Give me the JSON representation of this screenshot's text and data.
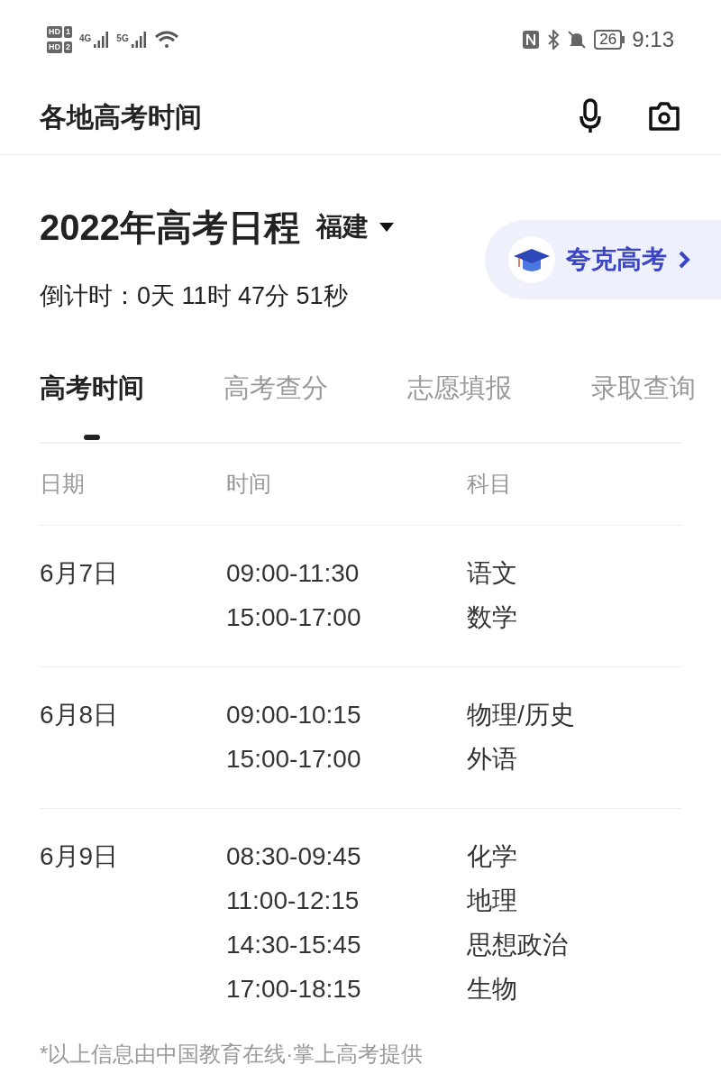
{
  "status_bar": {
    "sims": [
      {
        "label": "HD",
        "slot": "1"
      },
      {
        "label": "HD",
        "slot": "2"
      }
    ],
    "networks": [
      "4G",
      "5G"
    ],
    "battery": "26",
    "time": "9:13"
  },
  "header": {
    "title": "各地高考时间"
  },
  "schedule": {
    "title": "2022年高考日程",
    "region": "福建",
    "countdown_label": "倒计时：",
    "countdown": "0天 11时 47分 51秒",
    "promo": "夸克高考"
  },
  "tabs": [
    {
      "label": "高考时间",
      "selected": true
    },
    {
      "label": "高考查分",
      "selected": false
    },
    {
      "label": "志愿填报",
      "selected": false
    },
    {
      "label": "录取查询",
      "selected": false
    }
  ],
  "table": {
    "columns": [
      "日期",
      "时间",
      "科目"
    ],
    "rows": [
      {
        "date": "6月7日",
        "sessions": [
          {
            "time": "09:00-11:30",
            "subject": "语文"
          },
          {
            "time": "15:00-17:00",
            "subject": "数学"
          }
        ]
      },
      {
        "date": "6月8日",
        "sessions": [
          {
            "time": "09:00-10:15",
            "subject": "物理/历史"
          },
          {
            "time": "15:00-17:00",
            "subject": "外语"
          }
        ]
      },
      {
        "date": "6月9日",
        "sessions": [
          {
            "time": "08:30-09:45",
            "subject": "化学"
          },
          {
            "time": "11:00-12:15",
            "subject": "地理"
          },
          {
            "time": "14:30-15:45",
            "subject": "思想政治"
          },
          {
            "time": "17:00-18:15",
            "subject": "生物"
          }
        ]
      }
    ]
  },
  "footnote": "*以上信息由中国教育在线·掌上高考提供"
}
